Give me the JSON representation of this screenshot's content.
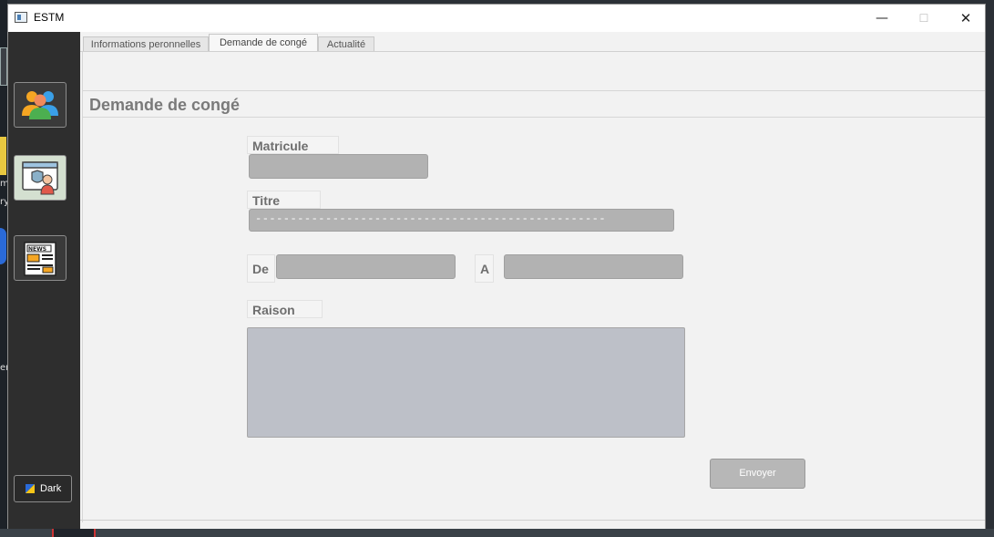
{
  "window": {
    "title": "ESTM",
    "controls": {
      "minimize": "—",
      "maximize": "☐",
      "close": "✕"
    }
  },
  "sidebar": {
    "items": [
      {
        "name": "employees",
        "icon": "users-group-icon"
      },
      {
        "name": "leave-request",
        "icon": "security-agent-icon"
      },
      {
        "name": "news",
        "icon": "newspaper-icon"
      }
    ],
    "theme_button": {
      "label": "Dark",
      "icon": "theme-palette-icon"
    }
  },
  "tabs": [
    {
      "label": "Informations peronnelles",
      "active": false
    },
    {
      "label": "Demande de congé",
      "active": true
    },
    {
      "label": "Actualité",
      "active": false
    }
  ],
  "form": {
    "title": "Demande de congé",
    "matricule_label": "Matricule",
    "matricule_value": "",
    "titre_label": "Titre",
    "titre_value": "--------------------------------------------------",
    "de_label": "De",
    "de_value": "",
    "a_label": "A",
    "a_value": "",
    "raison_label": "Raison",
    "raison_value": "",
    "submit_label": "Envoyer"
  },
  "desktop": {
    "fragments": [
      "m",
      "ry",
      "er"
    ]
  },
  "colors": {
    "sidebar_bg": "#2e2e2e",
    "content_bg": "#f2f2f2",
    "field_bg": "#b2b2b2",
    "textarea_bg": "#bdc0c8",
    "button_bg": "#b7b7b7"
  }
}
